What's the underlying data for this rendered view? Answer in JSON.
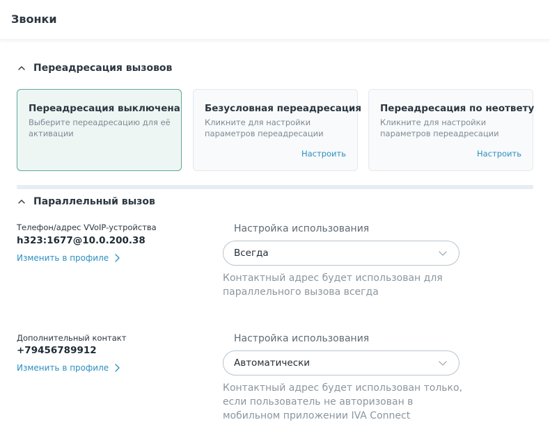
{
  "header": {
    "title": "Звонки"
  },
  "forwarding": {
    "title": "Переадресация вызовов",
    "cards": [
      {
        "title": "Переадресация выключена",
        "desc": "Выберите переадресацию для её активации",
        "link": ""
      },
      {
        "title": "Безусловная переадресация",
        "desc": "Кликните для настройки параметров переадресации",
        "link": "Настроить"
      },
      {
        "title": "Переадресация по неответу",
        "desc": "Кликните для настройки параметров переадресации",
        "link": "Настроить"
      }
    ]
  },
  "parallel": {
    "title": "Параллельный вызов",
    "contacts": [
      {
        "label": "Телефон/адрес VVoIP-устройства",
        "value": "h323:1677@10.0.200.38",
        "link": "Изменить в профиле",
        "usage_label": "Настройка использования",
        "select_value": "Всегда",
        "hint": "Контактный адрес будет использован для параллельного вызова всегда"
      },
      {
        "label": "Дополнительный контакт",
        "value": "+79456789912",
        "link": "Изменить в профиле",
        "usage_label": "Настройка использования",
        "select_value": "Автоматически",
        "hint": "Контактный адрес будет использован только, если пользователь не авторизован в мобильном приложении IVA Connect"
      }
    ]
  },
  "colors": {
    "accent": "#2a8fbf",
    "active_border": "#5fa79a",
    "active_bg": "#eef6f4"
  }
}
